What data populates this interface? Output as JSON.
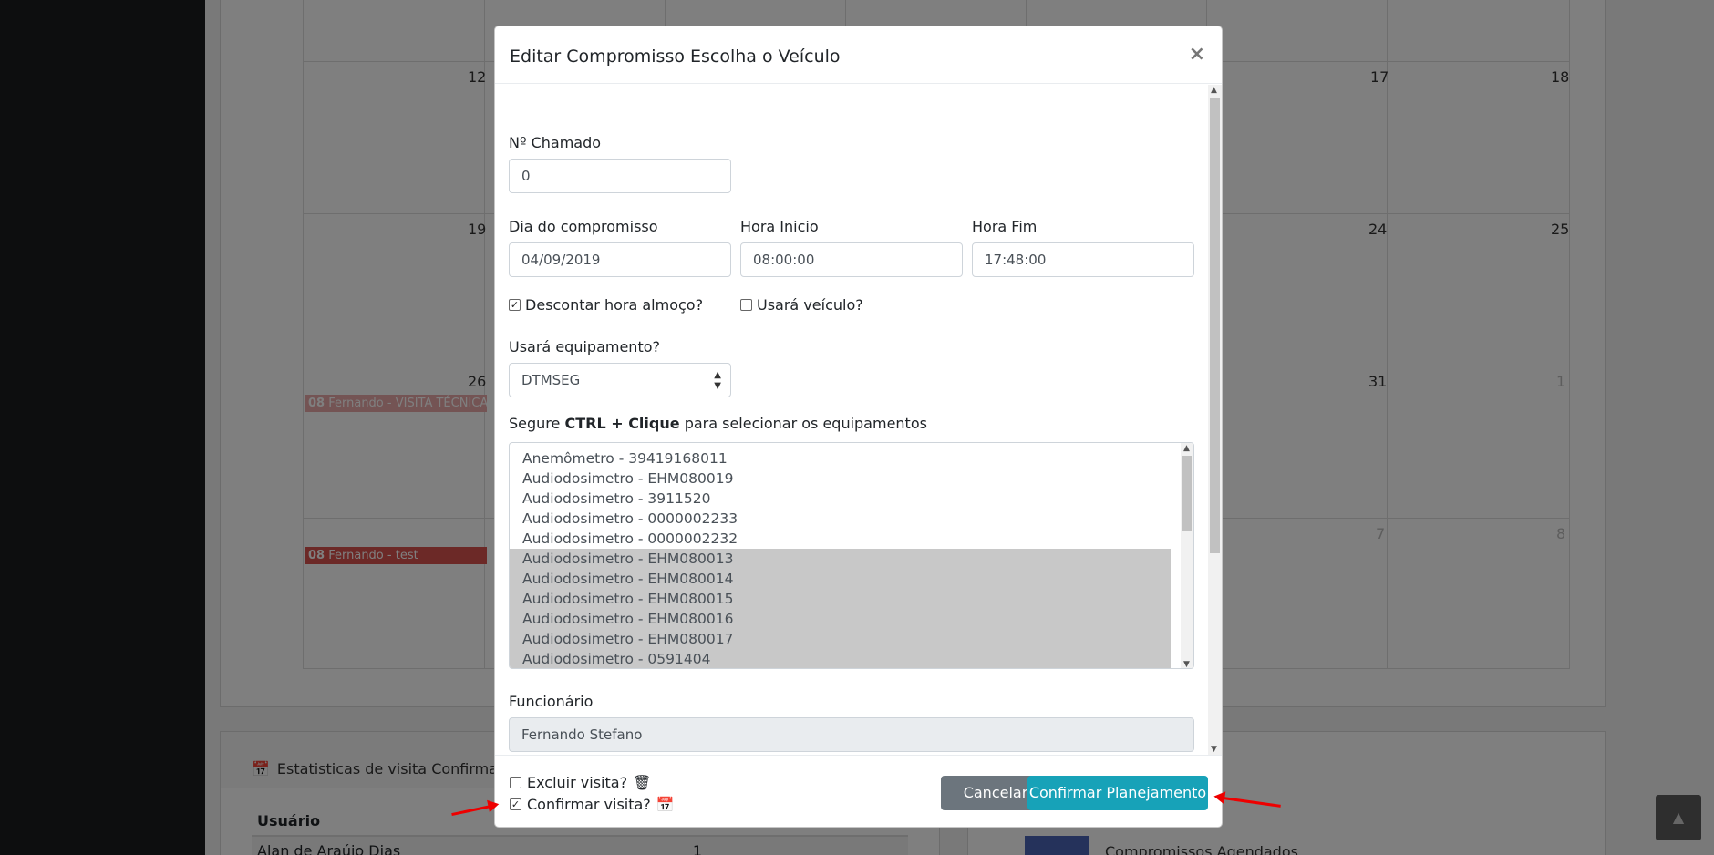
{
  "calendar": {
    "day_numbers": [
      {
        "label": "12",
        "muted": false
      },
      {
        "label": "17",
        "muted": false
      },
      {
        "label": "18",
        "muted": false
      },
      {
        "label": "19",
        "muted": false
      },
      {
        "label": "24",
        "muted": false
      },
      {
        "label": "25",
        "muted": false
      },
      {
        "label": "26",
        "muted": false
      },
      {
        "label": "31",
        "muted": false
      },
      {
        "label": "1",
        "muted": true
      },
      {
        "label": "7",
        "muted": true
      },
      {
        "label": "8",
        "muted": true
      }
    ],
    "events": [
      {
        "time": "08",
        "text": "Fernando - VISITA TÉCNICA",
        "color": "#e8a9a9"
      },
      {
        "time": "08",
        "text": "Fernando - test",
        "color": "#d9534f"
      }
    ]
  },
  "stats": {
    "title": "Estatisticas de visita Confirmadas/P",
    "column_user": "Usuário",
    "row_name": "Alan de Araújo Dias",
    "row_value": "1"
  },
  "legend": {
    "label": "Compromissos Agendados",
    "color": "#4a65b7"
  },
  "modal": {
    "title": "Editar Compromisso Escolha o Veículo",
    "close_symbol": "×",
    "chamado_label": "Nº Chamado",
    "chamado_value": "0",
    "dia_label": "Dia do compromisso",
    "dia_value": "04/09/2019",
    "hora_inicio_label": "Hora Inicio",
    "hora_inicio_value": "08:00:00",
    "hora_fim_label": "Hora Fim",
    "hora_fim_value": "17:48:00",
    "descontar_label": "Descontar hora almoço?",
    "descontar_checked": true,
    "veiculo_label": "Usará veículo?",
    "veiculo_checked": false,
    "equipamento_label": "Usará equipamento?",
    "equipamento_value": "DTMSEG",
    "hint_prefix": "Segure",
    "hint_bold": "CTRL + Clique",
    "hint_suffix": "para selecionar os equipamentos",
    "equipment_options": [
      {
        "label": "Anemômetro - 39419168011",
        "selected": false
      },
      {
        "label": "Audiodosimetro - EHM080019",
        "selected": false
      },
      {
        "label": "Audiodosimetro - 3911520",
        "selected": false
      },
      {
        "label": "Audiodosimetro - 0000002233",
        "selected": false
      },
      {
        "label": "Audiodosimetro - 0000002232",
        "selected": false
      },
      {
        "label": "Audiodosimetro - EHM080013",
        "selected": true
      },
      {
        "label": "Audiodosimetro - EHM080014",
        "selected": true
      },
      {
        "label": "Audiodosimetro - EHM080015",
        "selected": true
      },
      {
        "label": "Audiodosimetro - EHM080016",
        "selected": true
      },
      {
        "label": "Audiodosimetro - EHM080017",
        "selected": true
      },
      {
        "label": "Audiodosimetro - 0591404",
        "selected": true
      }
    ],
    "funcionario_label": "Funcionário",
    "funcionario_value": "Fernando Stefano",
    "footer": {
      "excluir_label": "Excluir visita?",
      "excluir_checked": false,
      "confirmar_label": "Confirmar visita?",
      "confirmar_checked": true,
      "cancel_label": "Cancelar",
      "confirm_label": "Confirmar Planejamento"
    }
  },
  "colors": {
    "primary_btn": "#17a2b8",
    "secondary_btn": "#6c757d",
    "annotation_arrow": "#e00000"
  }
}
